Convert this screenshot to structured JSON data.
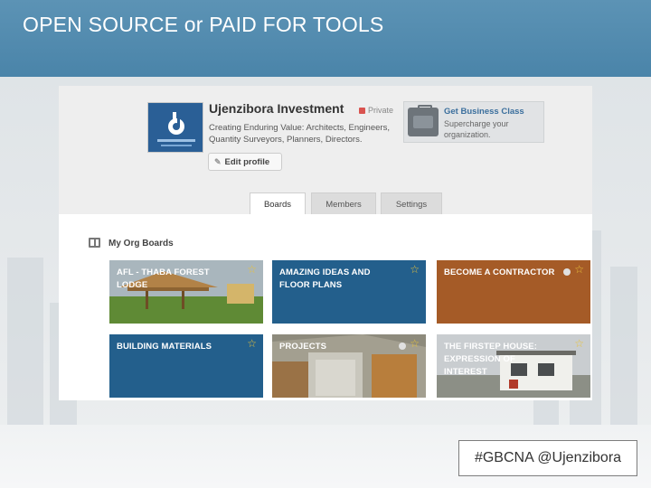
{
  "slide": {
    "title": "OPEN SOURCE or PAID FOR TOOLS",
    "hashtag": "#GBCNA @Ujenzibora"
  },
  "profile": {
    "org_name": "Ujenzibora Investment",
    "privacy": "Private",
    "description": "Creating Enduring Value: Architects, Engineers, Quantity Surveyors, Planners, Directors.",
    "edit_label": "Edit profile",
    "logo_icon": "ujenzibora-logo"
  },
  "promo": {
    "title": "Get Business Class",
    "subtitle": "Supercharge your organization.",
    "icon": "briefcase-icon"
  },
  "tabs": [
    {
      "label": "Boards",
      "active": true
    },
    {
      "label": "Members",
      "active": false
    },
    {
      "label": "Settings",
      "active": false
    }
  ],
  "boards_section": {
    "title": "My Org Boards",
    "icon": "boards-icon"
  },
  "boards": [
    {
      "label": "AFL - THABA FOREST LODGE",
      "color": "#6f8a4a",
      "starred": true
    },
    {
      "label": "AMAZING IDEAS AND FLOOR PLANS",
      "color": "#235f8c",
      "starred": true
    },
    {
      "label": "BECOME A CONTRACTOR",
      "color": "#a55b27",
      "starred": true
    },
    {
      "label": "BUILDING MATERIALS",
      "color": "#235f8c",
      "starred": true
    },
    {
      "label": "PROJECTS",
      "color": "#7c7c76",
      "starred": true
    },
    {
      "label": "THE FIRSTEP HOUSE: EXPRESSION OF INTEREST",
      "color": "#6d6c67",
      "starred": true
    }
  ]
}
